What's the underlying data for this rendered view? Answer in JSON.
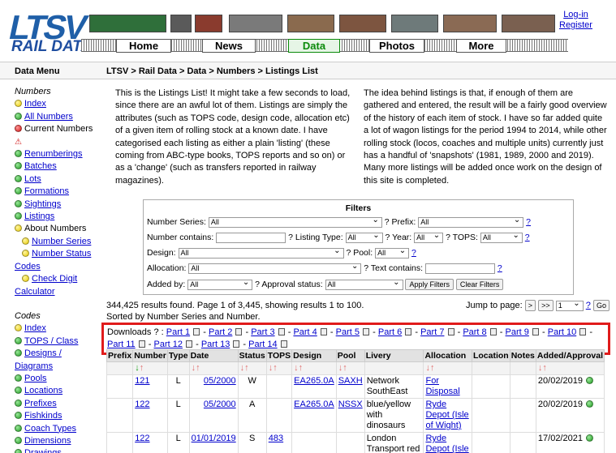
{
  "header": {
    "logo_top": "LTSV",
    "logo_bottom": "RAIL DATA",
    "nav": [
      "Home",
      "News",
      "Data",
      "Photos",
      "More"
    ],
    "active_nav": "Data",
    "login": "Log-in",
    "register": "Register"
  },
  "bar": {
    "menu_title": "Data Menu",
    "breadcrumb": "LTSV > Rail Data > Data > Numbers > Listings List"
  },
  "sidebar": {
    "numbers_heading": "Numbers",
    "numbers_items": [
      {
        "label": "Index",
        "dot": "yellow",
        "link": true
      },
      {
        "label": "All Numbers",
        "dot": "green",
        "link": true
      },
      {
        "label": "Current Numbers",
        "dot": "red",
        "link": false
      },
      {
        "label": "",
        "dot": "warn",
        "link": false
      },
      {
        "label": "Renumberings",
        "dot": "green",
        "link": true
      },
      {
        "label": "Batches",
        "dot": "green",
        "link": true
      },
      {
        "label": "Lots",
        "dot": "green",
        "link": true
      },
      {
        "label": "Formations",
        "dot": "green",
        "link": true
      },
      {
        "label": "Sightings",
        "dot": "green",
        "link": true
      },
      {
        "label": "Listings",
        "dot": "green",
        "link": true
      },
      {
        "label": "About Numbers",
        "dot": "yellow",
        "link": false
      },
      {
        "label": "Number Series",
        "dot": "yellow",
        "link": true,
        "indent": true
      },
      {
        "label": "Number Status",
        "dot": "yellow",
        "link": true,
        "indent": true
      }
    ],
    "codes_link": "Codes",
    "check_digit": "Check Digit",
    "calculator": "Calculator",
    "codes_heading": "Codes",
    "codes_items": [
      {
        "label": "Index",
        "dot": "yellow"
      },
      {
        "label": "TOPS / Class",
        "dot": "green"
      },
      {
        "label": "Designs /",
        "dot": "green"
      },
      {
        "label": "Diagrams",
        "dot": "none"
      },
      {
        "label": "Pools",
        "dot": "green"
      },
      {
        "label": "Locations",
        "dot": "green"
      },
      {
        "label": "Prefixes",
        "dot": "green"
      },
      {
        "label": "Fishkinds",
        "dot": "green"
      },
      {
        "label": "Coach Types",
        "dot": "green"
      },
      {
        "label": "Dimensions",
        "dot": "green"
      },
      {
        "label": "Drawings",
        "dot": "green"
      }
    ]
  },
  "intro": {
    "left": "This is the Listings List! It might take a few seconds to load, since there are an awful lot of them. Listings are simply the attributes (such as TOPS code, design code, allocation etc) of a given item of rolling stock at a known date. I have categorised each listing as either a plain 'listing' (these coming from ABC-type books, TOPS reports and so on) or as a 'change' (such as transfers reported in railway magazines).",
    "right": "The idea behind listings is that, if enough of them are gathered and entered, the result will be a fairly good overview of the history of each item of stock. I have so far added quite a lot of wagon listings for the period 1994 to 2014, while other rolling stock (locos, coaches and multiple units) currently just has a handful of 'snapshots' (1981, 1989, 2000 and 2019). Many more listings will be added once work on the design of this site is completed."
  },
  "filters": {
    "title": "Filters",
    "number_series_label": "Number Series:",
    "number_series_value": "All",
    "prefix_label": "? Prefix:",
    "prefix_value": "All",
    "q": "?",
    "number_contains_label": "Number contains:",
    "listing_type_label": "? Listing Type:",
    "listing_type_value": "All",
    "year_label": "? Year:",
    "year_value": "All",
    "tops_label": "? TOPS:",
    "tops_value": "All",
    "design_label": "Design:",
    "design_value": "All",
    "pool_label": "? Pool:",
    "pool_value": "All",
    "allocation_label": "Allocation:",
    "allocation_value": "All",
    "text_contains_label": "? Text contains:",
    "added_by_label": "Added by:",
    "added_by_value": "All",
    "approval_label": "? Approval status:",
    "approval_value": "All",
    "apply": "Apply Filters",
    "clear": "Clear Filters"
  },
  "results": {
    "line1": "344,425 results found. Page 1 of 3,445, showing results 1 to 100.",
    "line2": "Sorted by Number Series and Number.",
    "jump_label": "Jump to page:",
    "next": ">",
    "last": ">>",
    "page_value": "1",
    "q": "?",
    "go": "Go"
  },
  "downloads": {
    "label": "Downloads ? :",
    "parts": [
      "Part 1",
      "Part 2",
      "Part 3",
      "Part 4",
      "Part 5",
      "Part 6",
      "Part 7",
      "Part 8",
      "Part 9",
      "Part 10",
      "Part 11",
      "Part 12",
      "Part 13",
      "Part 14"
    ]
  },
  "table": {
    "headers": [
      "Prefix",
      "Number",
      "Type",
      "Date",
      "Status",
      "TOPS",
      "Design",
      "Pool",
      "Livery",
      "Allocation",
      "Location",
      "Notes",
      "Added/Approval"
    ],
    "rows": [
      {
        "prefix": "",
        "number": "121",
        "type": "L",
        "date": "05/2000",
        "status": "W",
        "tops": "",
        "design": "EA265.0A",
        "pool": "SAXH",
        "livery": "Network SouthEast",
        "allocation": "For Disposal",
        "location": "",
        "notes": "",
        "added": "20/02/2019"
      },
      {
        "prefix": "",
        "number": "122",
        "type": "L",
        "date": "05/2000",
        "status": "A",
        "tops": "",
        "design": "EA265.0A",
        "pool": "NSSX",
        "livery": "blue/yellow with dinosaurs",
        "allocation": "Ryde Depot (Isle of Wight)",
        "location": "",
        "notes": "",
        "added": "20/02/2019"
      },
      {
        "prefix": "",
        "number": "122",
        "type": "L",
        "date": "01/01/2019",
        "status": "S",
        "tops": "483",
        "design": "",
        "pool": "",
        "livery": "London Transport red",
        "allocation": "Ryde Depot (Isle of Wight)",
        "location": "",
        "notes": "",
        "added": "17/02/2021"
      }
    ]
  },
  "colors": {
    "brand_blue": "#1f5fa8",
    "active_green": "#0a8a0a",
    "highlight_red": "#e01b1b"
  }
}
